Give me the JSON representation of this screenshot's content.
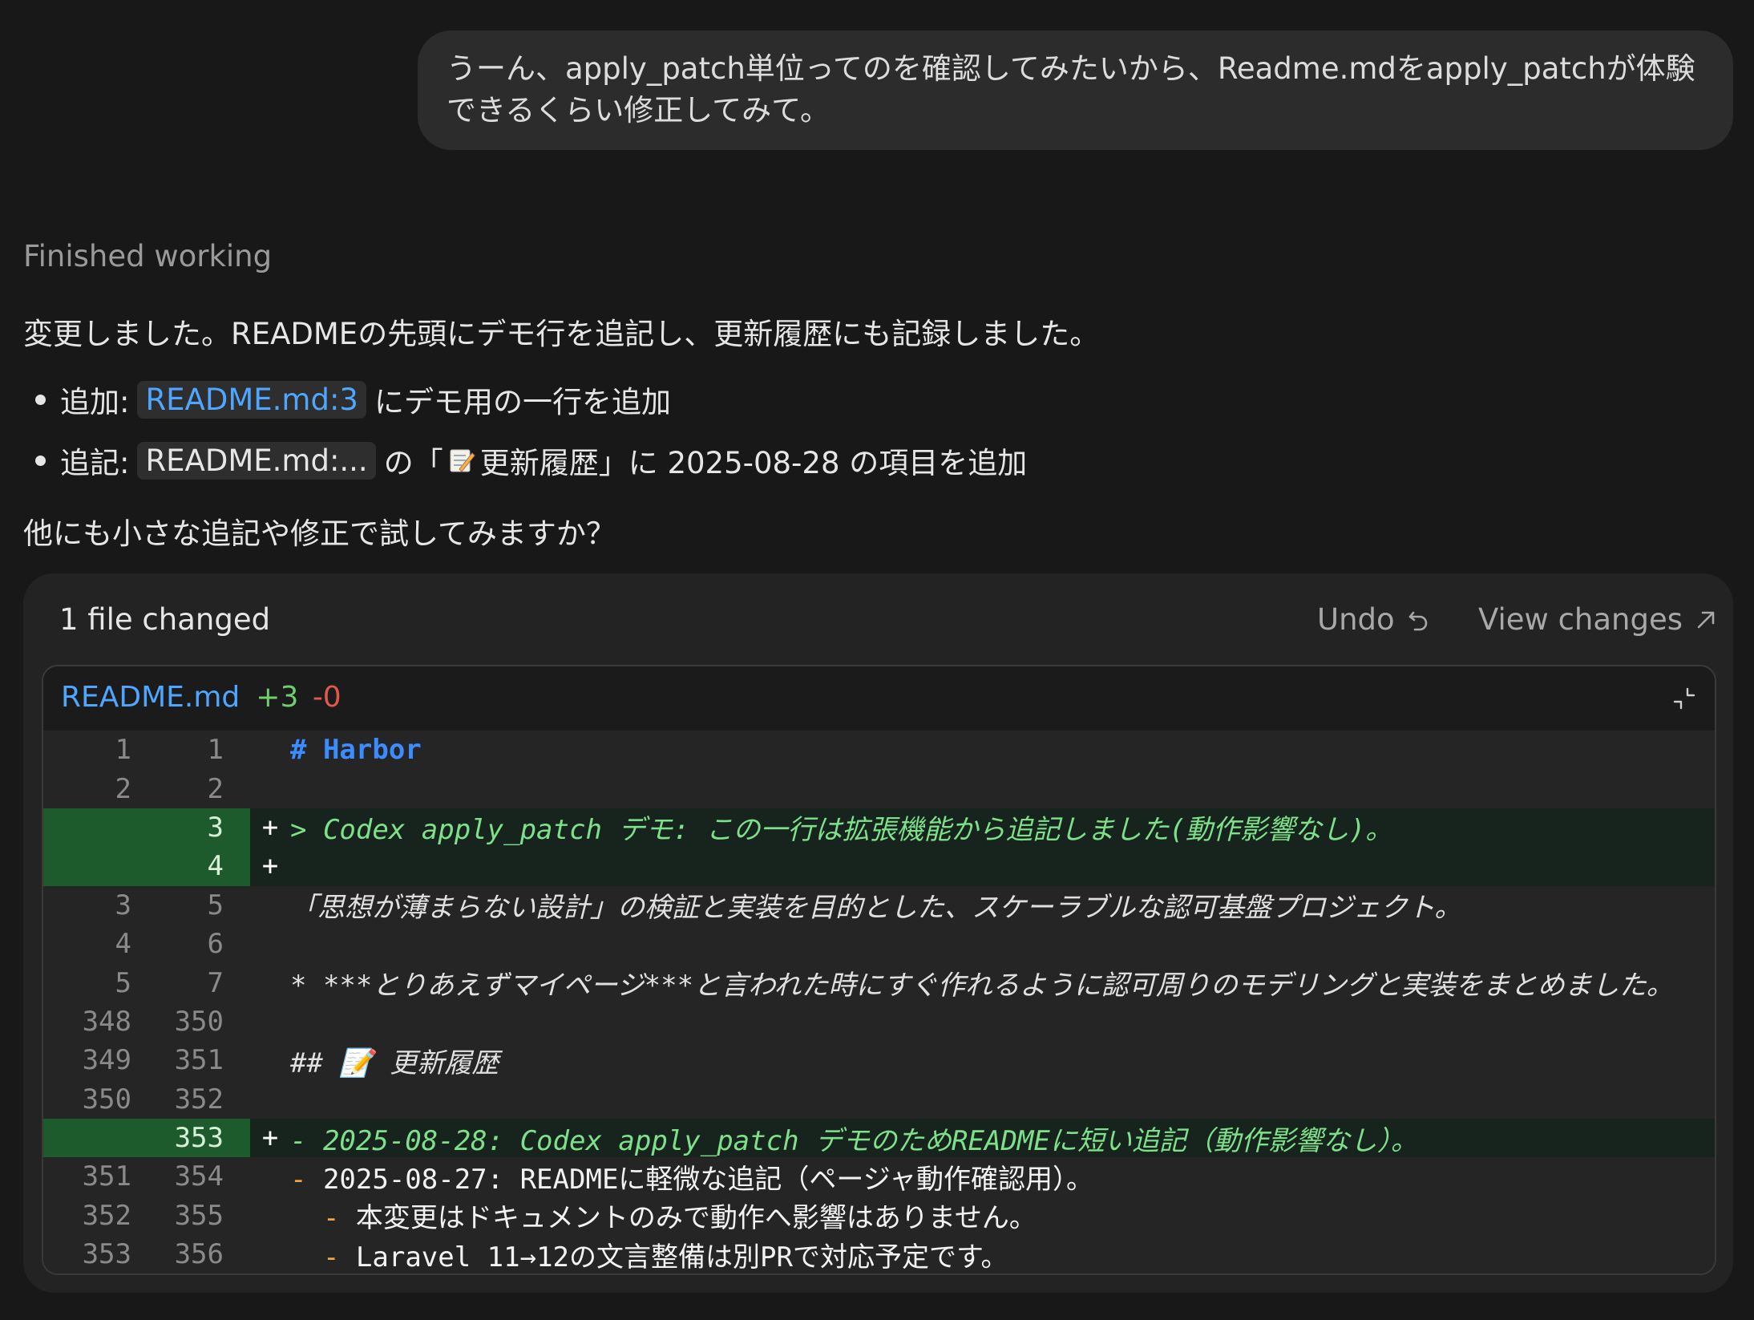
{
  "user_message": "うーん、apply_patch単位ってのを確認してみたいから、Readme.mdをapply_patchが体験できるくらい修正してみて。",
  "assistant": {
    "status": "Finished working",
    "intro": "変更しました。READMEの先頭にデモ行を追記し、更新履歴にも記録しました。",
    "bullets": [
      {
        "prefix": "追加:",
        "chip": "README.md:3",
        "chip_link": true,
        "suffix": "にデモ用の一行を追加"
      },
      {
        "prefix": "追記:",
        "chip": "README.md:...",
        "chip_link": false,
        "suffix_a": "の「",
        "emoji": "memo-icon",
        "suffix_b": "更新履歴」に 2025-08-28 の項目を追加"
      }
    ],
    "question": "他にも小さな追記や修正で試してみますか？"
  },
  "card": {
    "title": "1 file changed",
    "undo_label": "Undo",
    "view_label": "View changes",
    "file": {
      "name": "README.md",
      "added": "+3",
      "removed": "-0"
    },
    "rows": [
      {
        "old": "1",
        "new": "1",
        "sign": "",
        "type": "ctx",
        "style": "heading",
        "text": "# Harbor"
      },
      {
        "old": "2",
        "new": "2",
        "sign": "",
        "type": "ctx",
        "style": "plain",
        "text": ""
      },
      {
        "old": "",
        "new": "3",
        "sign": "+",
        "type": "add",
        "style": "plain",
        "text": "> Codex apply_patch デモ: この一行は拡張機能から追記しました(動作影響なし)。"
      },
      {
        "old": "",
        "new": "4",
        "sign": "+",
        "type": "add",
        "style": "plain",
        "text": ""
      },
      {
        "old": "3",
        "new": "5",
        "sign": "",
        "type": "ctx",
        "style": "it",
        "text": "「思想が薄まらない設計」の検証と実装を目的とした、スケーラブルな認可基盤プロジェクト。"
      },
      {
        "old": "4",
        "new": "6",
        "sign": "",
        "type": "ctx",
        "style": "plain",
        "text": ""
      },
      {
        "old": "5",
        "new": "7",
        "sign": "",
        "type": "ctx",
        "style": "it",
        "text": "* ***とりあえずマイページ***と言われた時にすぐ作れるように認可周りのモデリングと実装をまとめました。"
      },
      {
        "old": "348",
        "new": "350",
        "sign": "",
        "type": "ctx",
        "style": "plain",
        "text": ""
      },
      {
        "old": "349",
        "new": "351",
        "sign": "",
        "type": "ctx",
        "style": "it",
        "text": "## 📝 更新履歴"
      },
      {
        "old": "350",
        "new": "352",
        "sign": "",
        "type": "ctx",
        "style": "plain",
        "text": ""
      },
      {
        "old": "",
        "new": "353",
        "sign": "+",
        "type": "add",
        "style": "plain",
        "text": "- 2025-08-28: Codex apply_patch デモのためREADMEに短い追記（動作影響なし）。"
      },
      {
        "old": "351",
        "new": "354",
        "sign": "",
        "type": "ctx",
        "style": "dash",
        "text": "- 2025-08-27: READMEに軽微な追記（ページャ動作確認用）。"
      },
      {
        "old": "352",
        "new": "355",
        "sign": "",
        "type": "ctx",
        "style": "subdash",
        "text": "  - 本変更はドキュメントのみで動作へ影響はありません。"
      },
      {
        "old": "353",
        "new": "356",
        "sign": "",
        "type": "ctx",
        "style": "subdash",
        "text": "  - Laravel 11→12の文言整備は別PRで対応予定です。"
      }
    ]
  }
}
